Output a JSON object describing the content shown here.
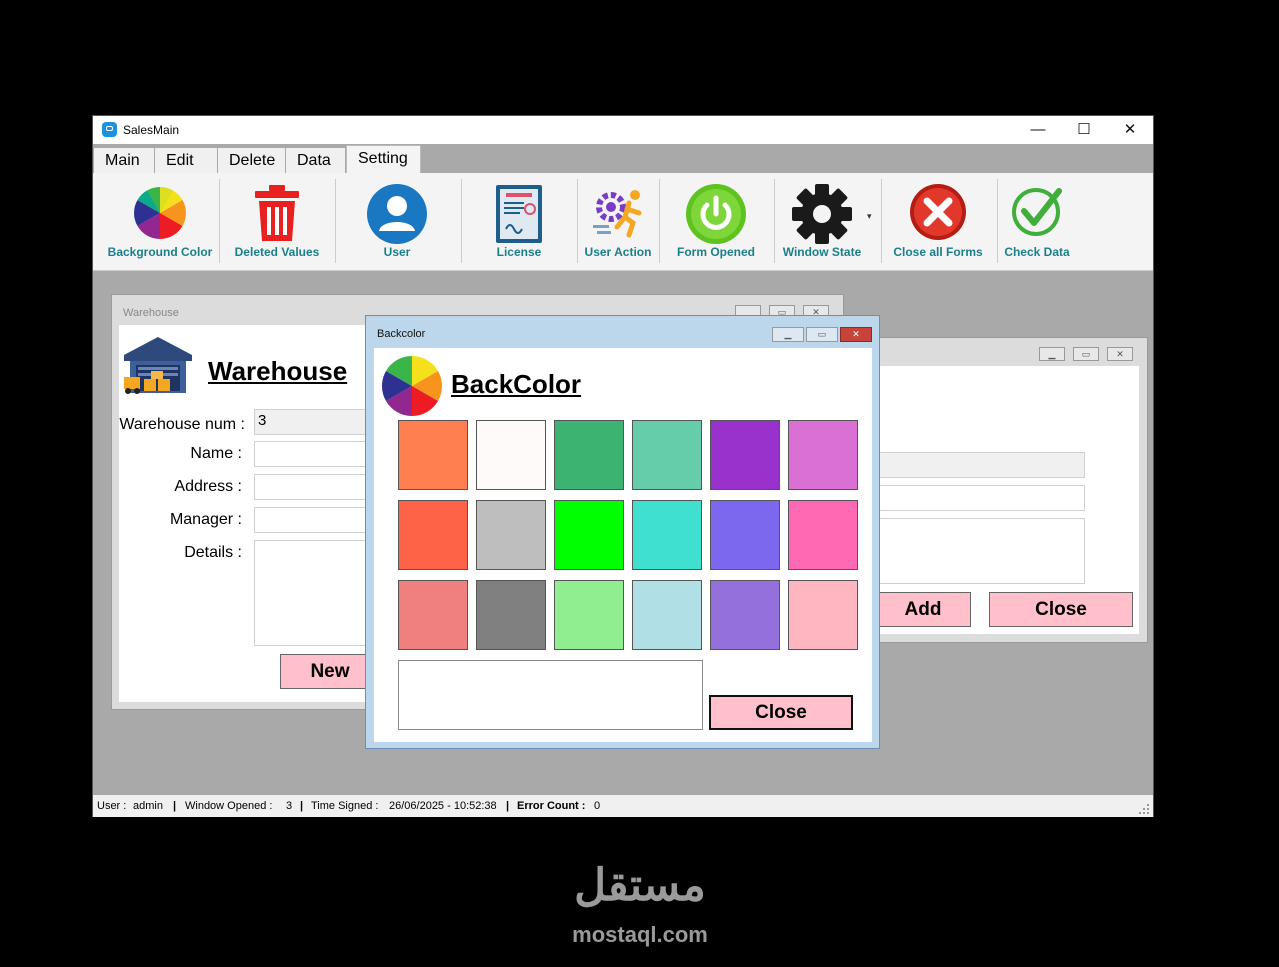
{
  "window": {
    "title": "SalesMain",
    "minimize": "—",
    "maximize": "☐",
    "close": "✕"
  },
  "menu": {
    "tabs": [
      "Main",
      "Edit",
      "Delete",
      "Data",
      "Setting"
    ],
    "active": "Setting"
  },
  "toolbar": {
    "items": [
      {
        "label": "Background Color",
        "icon": "color-wheel-icon"
      },
      {
        "label": "Deleted Values",
        "icon": "trash-icon"
      },
      {
        "label": "User",
        "icon": "user-icon"
      },
      {
        "label": "License",
        "icon": "license-icon"
      },
      {
        "label": "User Action",
        "icon": "user-action-icon"
      },
      {
        "label": "Form Opened",
        "icon": "power-icon"
      },
      {
        "label": "Window State",
        "icon": "gear-icon"
      },
      {
        "label": "Close all Forms",
        "icon": "close-all-icon"
      },
      {
        "label": "Check Data",
        "icon": "check-icon"
      }
    ],
    "dropdown_arrow": "▾"
  },
  "warehouse": {
    "title": "Warehouse",
    "heading": "Warehouse",
    "fields": {
      "num_label": "Warehouse num :",
      "num_value": "3",
      "name_label": "Name :",
      "address_label": "Address :",
      "manager_label": "Manager :",
      "details_label": "Details :"
    },
    "new_button": "New"
  },
  "second_form": {
    "add_button": "Add",
    "close_button": "Close"
  },
  "backcolor": {
    "title": "Backcolor",
    "heading": "BackColor",
    "colors": [
      "#ff7f50",
      "#fffafa",
      "#3cb371",
      "#66cdaa",
      "#9932cc",
      "#da70d6",
      "#ff6347",
      "#bebebe",
      "#00ff00",
      "#40e0d0",
      "#7b68ee",
      "#ff69b4",
      "#f08080",
      "#808080",
      "#90ee90",
      "#b0e0e6",
      "#9370db",
      "#ffb6c1"
    ],
    "close_button": "Close"
  },
  "status": {
    "user_label": "User :",
    "user_value": "admin",
    "window_label": "Window Opened :",
    "window_value": "3",
    "time_label": "Time Signed :",
    "time_value": "26/06/2025 - 10:52:38",
    "error_label": "Error Count :",
    "error_value": "0",
    "sep": "|"
  },
  "watermark": {
    "arabic": "مستقل",
    "latin": "mostaql.com"
  }
}
